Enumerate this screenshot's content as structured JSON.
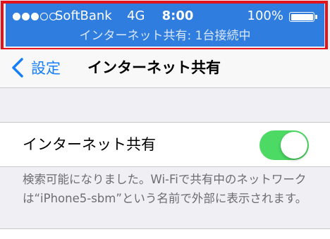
{
  "status_bar": {
    "carrier": "SoftBank",
    "network": "4G",
    "time": "8:00",
    "battery_percent": "100%",
    "battery_level": 1.0,
    "signal_bars": 3,
    "signal_total": 5,
    "hotspot_message": "インターネット共有: 1台接続中",
    "background_color": "#2f7ddf"
  },
  "highlight_color": "#e3131b",
  "navbar": {
    "back_label": "設定",
    "back_icon": "chevron-left-icon",
    "title": "インターネット共有",
    "tint_color": "#157efb"
  },
  "setting": {
    "label": "インターネット共有",
    "enabled": true,
    "toggle_color": "#4cd964"
  },
  "footnote": "検索可能になりました。Wi-Fiで共有中のネットワークは“iPhone5-sbm”という名前で外部に表示されます。"
}
